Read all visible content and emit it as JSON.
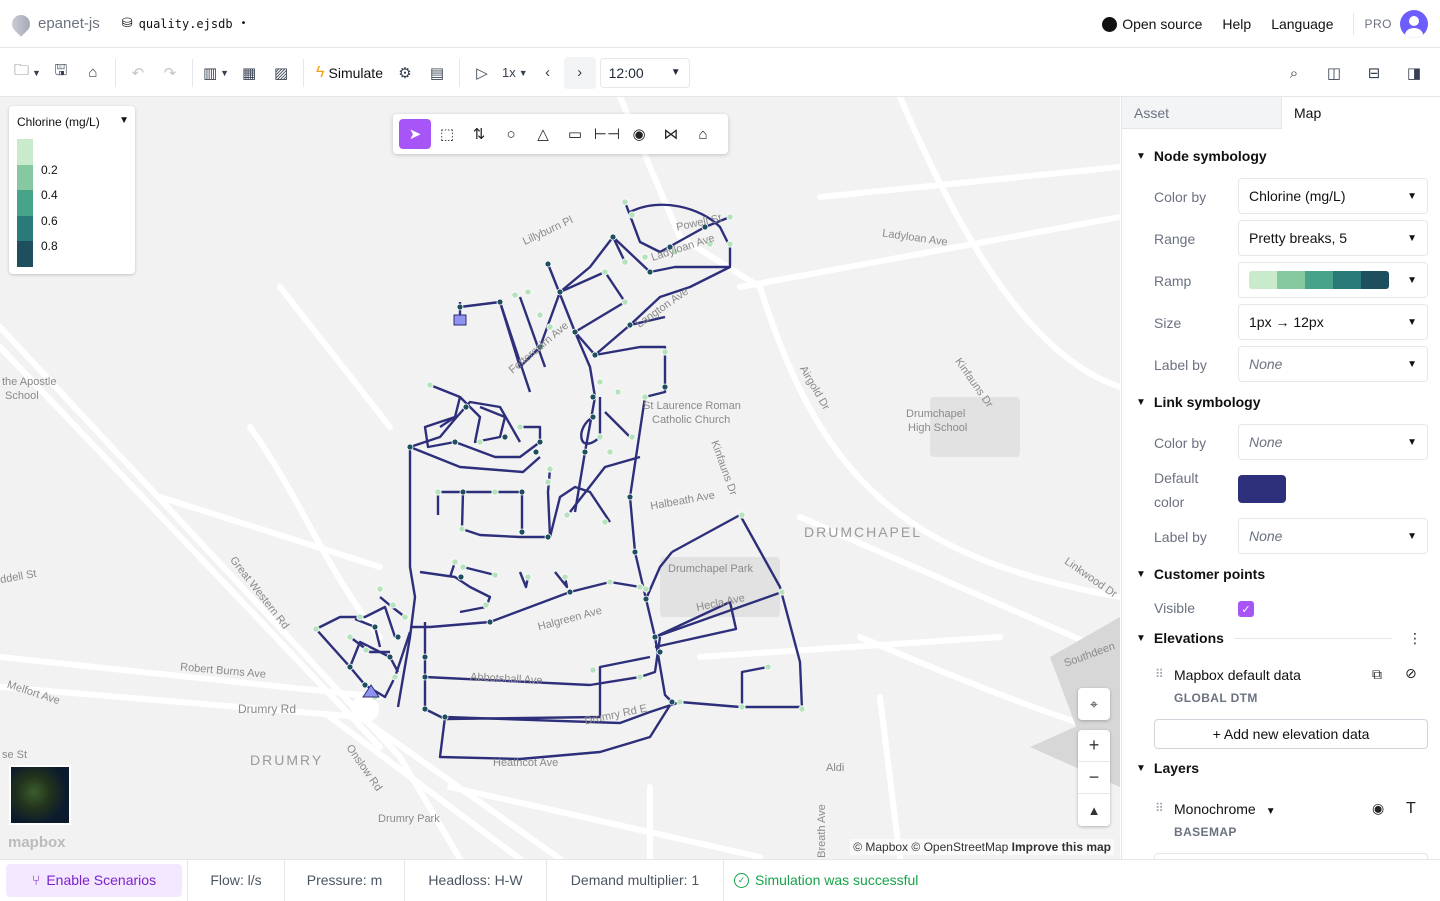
{
  "app": {
    "name": "epanet-js",
    "filename": "quality.ejsdb",
    "unsaved_marker": "•"
  },
  "header_links": {
    "open_source": "Open source",
    "help": "Help",
    "language": "Language",
    "pro": "PRO"
  },
  "toolbar": {
    "simulate_label": "Simulate",
    "speed": "1x",
    "time": "12:00"
  },
  "legend": {
    "title": "Chlorine (mg/L)",
    "values": [
      "0.2",
      "0.4",
      "0.6",
      "0.8"
    ],
    "colors": [
      "#c9ebcc",
      "#86c9a0",
      "#48a38b",
      "#2b7a7a",
      "#1d4f5e"
    ]
  },
  "map_labels": {
    "l1": "Lillyburn Pl",
    "l2": "Ladyloan Ave",
    "l3": "Powell St",
    "l4": "Ladyloan Ave",
    "l5": "Langton Ave",
    "l6": "Fettercairn Ave",
    "l7": "St Laurence Roman",
    "l8": "Catholic Church",
    "l9": "Airgold Dr",
    "l10": "Kinfauns Dr",
    "l11": "Drumchapel",
    "l12": "High School",
    "l13": "Kinfauns Dr",
    "l14": "Halbeath Ave",
    "l15": "DRUMCHAPEL",
    "l16": "Drumchapel Park",
    "l17": "Hecla Ave",
    "l18": "Halgreen Ave",
    "l19": "Linkwood Dr",
    "l20": "Southdeen",
    "l21": "Great Western Rd",
    "l22": "Robert Burns Ave",
    "l23": "Drumry Rd",
    "l24": "Melfort Ave",
    "l25": "DRUMRY",
    "l26": "Onslow Rd",
    "l27": "Abbotshall Ave",
    "l28": "Drumry Rd E",
    "l29": "Heathcot Ave",
    "l30": "Aldi",
    "l31": "Drumry Park",
    "l32": "the Apostle",
    "l33": "School",
    "l34": "ddell St",
    "l35": "se St",
    "l36": "Breath Ave"
  },
  "attribution": {
    "mapbox": "© Mapbox",
    "osm": "© OpenStreetMap",
    "improve": "Improve this map",
    "logo": "mapbox"
  },
  "panel": {
    "tabs": [
      "Asset",
      "Map"
    ],
    "node_symbology": {
      "title": "Node symbology",
      "color_by_label": "Color by",
      "color_by": "Chlorine (mg/L)",
      "range_label": "Range",
      "range": "Pretty breaks, 5",
      "ramp_label": "Ramp",
      "size_label": "Size",
      "size": "1px → 12px",
      "label_by_label": "Label by",
      "label_by": "None"
    },
    "link_symbology": {
      "title": "Link symbology",
      "color_by_label": "Color by",
      "color_by": "None",
      "default_color_label_1": "Default",
      "default_color_label_2": "color",
      "default_color": "#2e2f7a",
      "label_by_label": "Label by",
      "label_by": "None"
    },
    "customer_points": {
      "title": "Customer points",
      "visible_label": "Visible"
    },
    "elevations": {
      "title": "Elevations",
      "item_title": "Mapbox default data",
      "item_sub": "GLOBAL DTM",
      "add_label": "+ Add new elevation data"
    },
    "layers": {
      "title": "Layers",
      "item_title": "Monochrome",
      "item_sub": "BASEMAP"
    }
  },
  "statusbar": {
    "scenarios": "Enable Scenarios",
    "flow": "Flow: l/s",
    "pressure": "Pressure: m",
    "headloss": "Headloss: H-W",
    "demand": "Demand multiplier: 1",
    "result": "Simulation was successful"
  }
}
